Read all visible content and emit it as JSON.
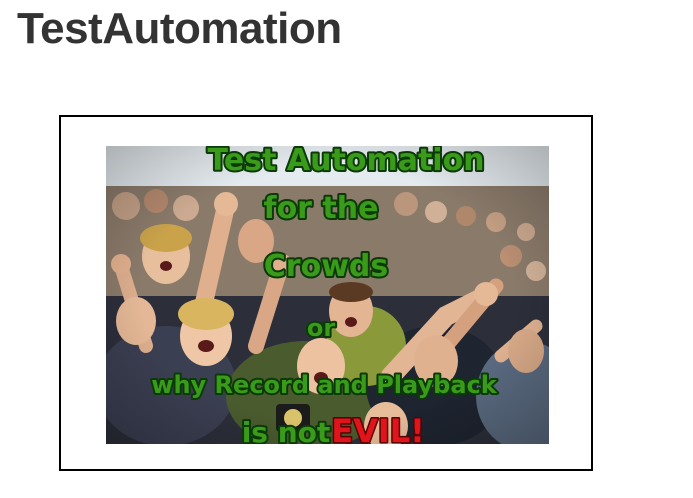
{
  "page": {
    "title": "TestAutomation"
  },
  "image": {
    "subject": "crowd-photo",
    "overlay_lines": [
      "Test Automation",
      "for the",
      "Crowds",
      "or",
      "why Record and Playback",
      "is not"
    ],
    "emphasis_word": "EVIL!",
    "colors": {
      "overlay_text": "#3a9a1a",
      "overlay_outline": "#0b3a08",
      "emphasis": "#e0151b",
      "frame_border": "#000000",
      "title": "#333333"
    }
  }
}
